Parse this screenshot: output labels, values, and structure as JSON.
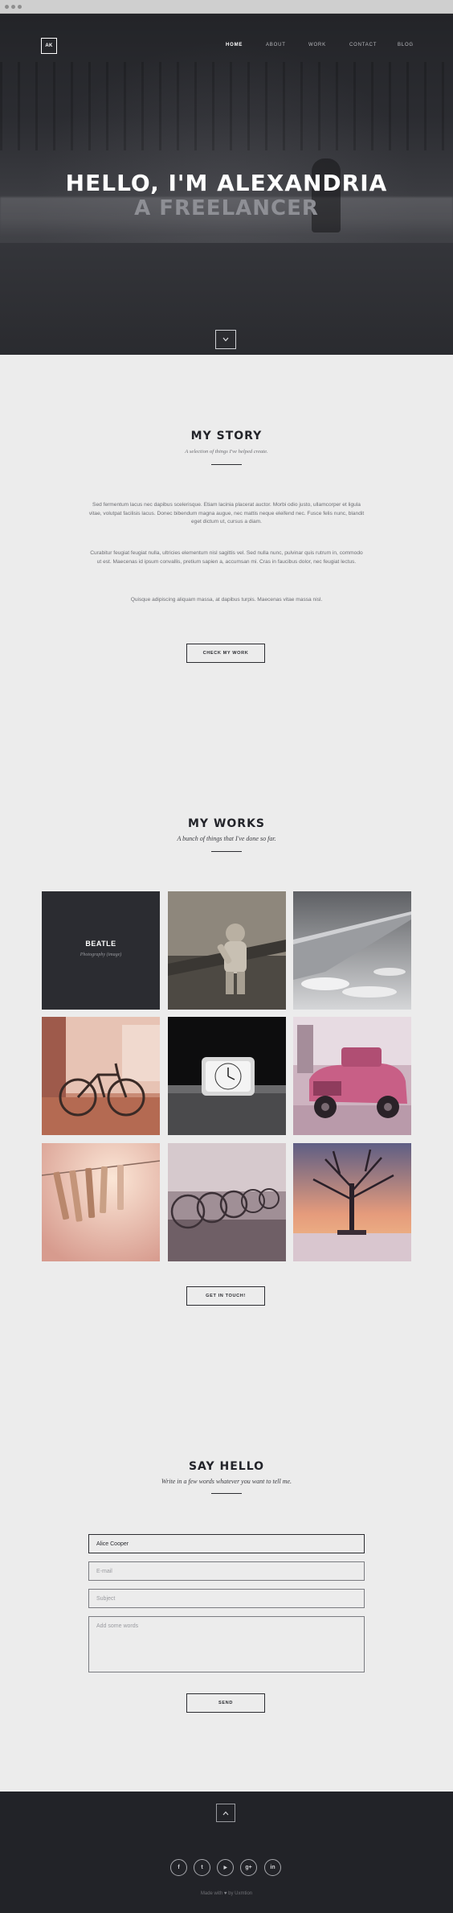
{
  "brand": {
    "logo_text": "AK"
  },
  "nav": {
    "items": [
      "HOME",
      "ABOUT",
      "WORK",
      "CONTACT",
      "BLOG"
    ],
    "active": "HOME"
  },
  "hero": {
    "line1": "HELLO, I'M ALEXANDRIA",
    "line2": "A FREELANCER"
  },
  "story": {
    "title": "MY STORY",
    "subtitle": "A selection of things I've helped create.",
    "paragraphs": [
      "Sed fermentum lacus nec dapibus scelerisque. Etiam lacinia placerat auctor. Morbi odio justo, ullamcorper et ligula vitae, volutpat facilisis lacus. Donec bibendum magna augue, nec mattis neque eleifend nec. Fusce felis nunc, blandit eget dictum ut, cursus a diam.",
      "Curabitur feugiat feugiat nulla, ultricies elementum nisl sagittis vel. Sed nulla nunc, pulvinar quis rutrum in, commodo ut est. Maecenas id ipsum convallis, pretium sapien a, accumsan mi. Cras in faucibus dolor, nec feugiat lectus.",
      "Quisque adipiscing aliquam massa, at dapibus turpis. Maecenas vitae massa nisl."
    ],
    "button": "CHECK MY WORK"
  },
  "works": {
    "title": "MY WORKS",
    "subtitle": "A bunch of things that I've done so far.",
    "featured": {
      "title": "BEATLE",
      "caption": "Photography (image)"
    },
    "button": "GET IN TOUCH!"
  },
  "contact": {
    "title": "SAY HELLO",
    "subtitle": "Write in a few words whatever you want to tell me.",
    "name_value": "Alice Cooper",
    "email_placeholder": "E-mail",
    "subject_placeholder": "Subject",
    "message_placeholder": "Add some words",
    "button": "SEND"
  },
  "footer": {
    "social": [
      "f",
      "t",
      "play",
      "g+",
      "in"
    ],
    "made_prefix": "Made with",
    "made_suffix": "by Uxmtion"
  },
  "colors": {
    "dark": "#2b2c31",
    "page_bg": "#ececec",
    "footer_bg": "#222328"
  }
}
